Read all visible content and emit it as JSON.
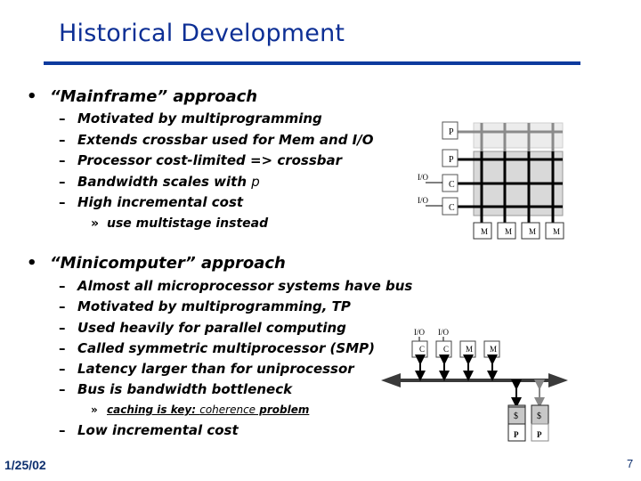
{
  "slide": {
    "title": "Historical Development",
    "sections": [
      {
        "heading": "“Mainframe” approach",
        "items": [
          "Motivated by multiprogramming",
          "Extends crossbar used for Mem and I/O",
          "Processor cost-limited => crossbar",
          "Bandwidth scales with ",
          "High incremental cost"
        ],
        "bandwidth_var": "p",
        "subitem": "use multistage instead"
      },
      {
        "heading": "“Minicomputer” approach",
        "items": [
          "Almost all microprocessor systems have bus",
          "Motivated by multiprogramming, TP",
          "Used heavily for parallel computing",
          "Called symmetric multiprocessor (SMP)",
          "Latency larger than for uniprocessor",
          "Bus is bandwidth bottleneck"
        ],
        "subitem_part1": "caching is key: ",
        "subitem_part2": "coherence",
        "subitem_part3": " problem",
        "last_item": "Low incremental cost"
      }
    ],
    "bullet_glyph": "•",
    "dash_glyph": "–",
    "subbullet_glyph": "»"
  },
  "crossbar_diagram": {
    "processor_labels": [
      "P",
      "P"
    ],
    "controller_labels": [
      "C",
      "C"
    ],
    "io_labels": [
      "I/O",
      "I/O"
    ],
    "memory_labels": [
      "M",
      "M",
      "M",
      "M"
    ]
  },
  "bus_diagram": {
    "io_labels": [
      "I/O",
      "I/O"
    ],
    "top_modules": [
      "C",
      "C",
      "M",
      "M"
    ],
    "cache_labels": [
      "$",
      "$"
    ],
    "processor_labels": [
      "P",
      "P"
    ]
  },
  "footer": {
    "date": "1/25/02",
    "page_number": "7"
  },
  "colors": {
    "title": "#0d2f95",
    "rule": "#0d3a9e",
    "footer": "#0d2f6e"
  }
}
